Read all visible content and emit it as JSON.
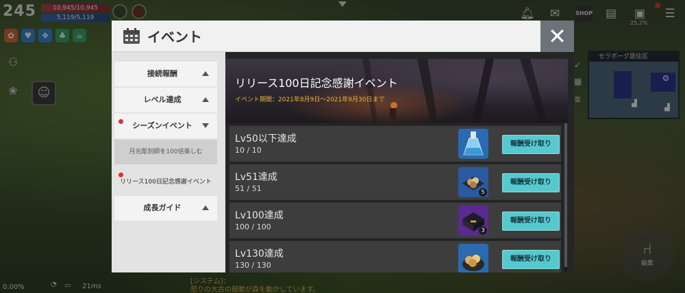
{
  "hud": {
    "level": "245",
    "hp": "10,945/10,945",
    "mp": "5,119/5,119",
    "network_pct": "0.00%",
    "ping": "21ms",
    "storage_pct": "25.2%"
  },
  "minimap": {
    "title": "セラボーグ居住区"
  },
  "chat": {
    "line1": "[システム]：",
    "line2": "怒りの大古の鼓動が森を動かしています。"
  },
  "edit_button": {
    "label": "編集"
  },
  "dialog": {
    "title": "イベント",
    "close_label": "✕"
  },
  "nav": {
    "items": [
      {
        "label": "接続報酬"
      },
      {
        "label": "レベル達成"
      },
      {
        "label": "シーズンイベント"
      },
      {
        "label": "月光彫刻師を100倍楽しむ"
      },
      {
        "label": "リリース100日記念感謝イベント"
      },
      {
        "label": "成長ガイド"
      }
    ]
  },
  "banner": {
    "title": "リリース100日記念感謝イベント",
    "period": "イベント期間：2021年8月9日〜2021年9月30日まで"
  },
  "missions": [
    {
      "name": "Lv50以下達成",
      "progress": "10 / 10",
      "reward_icon": "potion-icon",
      "reward_count": "",
      "button": "報酬受け取り"
    },
    {
      "name": "Lv51達成",
      "progress": "51 / 51",
      "reward_icon": "ore-box-icon",
      "reward_count": "5",
      "button": "報酬受け取り"
    },
    {
      "name": "Lv100達成",
      "progress": "100 / 100",
      "reward_icon": "chest-icon",
      "reward_count": "3",
      "button": "報酬受け取り"
    },
    {
      "name": "Lv130達成",
      "progress": "130 / 130",
      "reward_icon": "gold-pile-icon",
      "reward_count": "",
      "button": "報酬受け取り"
    }
  ],
  "colors": {
    "accent_button": "#56c9cf",
    "period_text": "#f0b538",
    "notify_dot": "#e2302a"
  }
}
